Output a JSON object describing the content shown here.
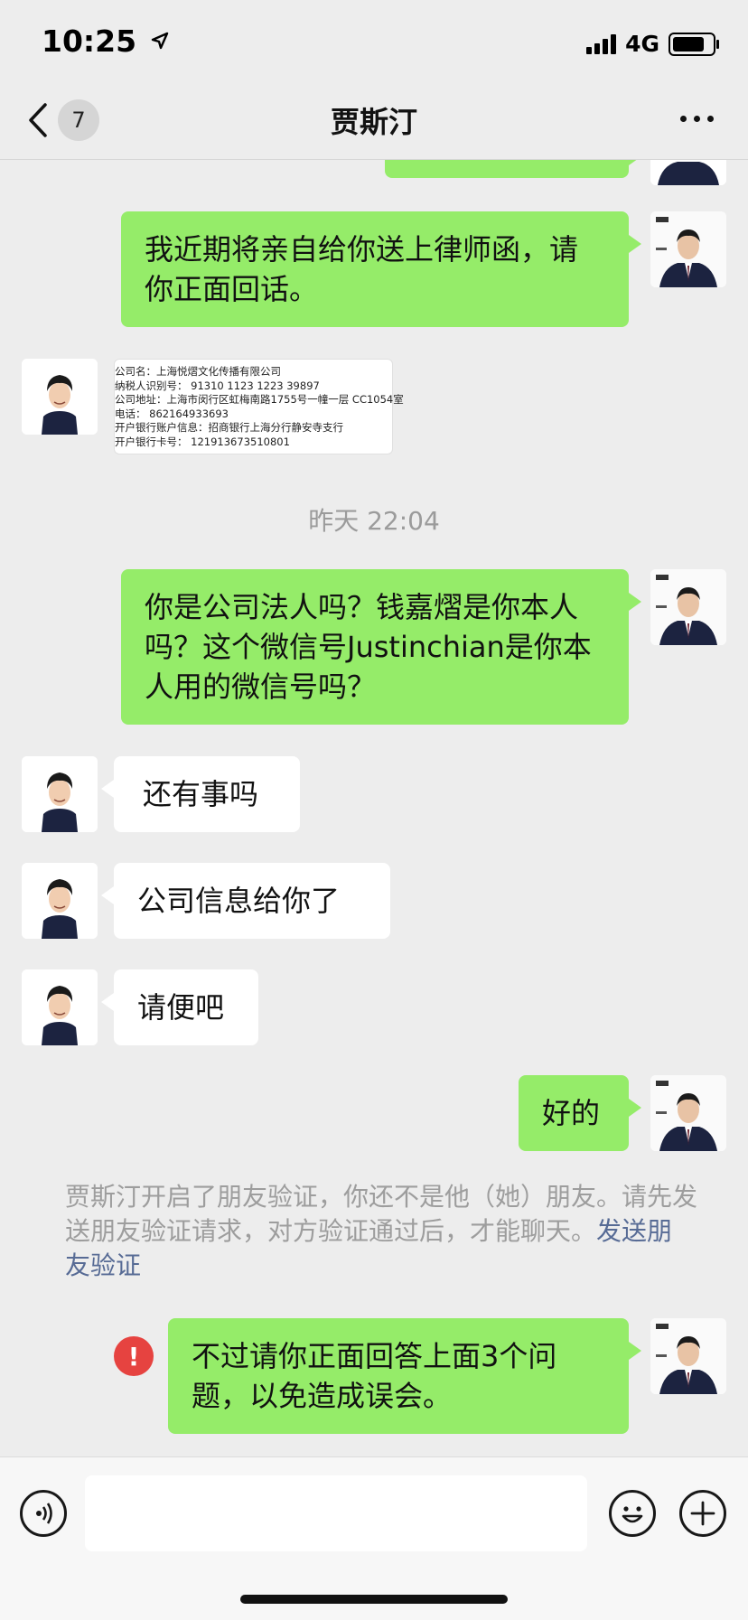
{
  "status": {
    "time": "10:25",
    "network": "4G"
  },
  "nav": {
    "title": "贾斯汀",
    "unread": "7"
  },
  "messages": {
    "m1": "我近期将亲自给你送上律师函，请你正面回话。",
    "card_lines": [
      "公司名：上海悦熠文化传播有限公司",
      "纳税人识别号：  91310 1123 1223 39897",
      "公司地址：上海市闵行区虹梅南路1755号一幢一层 CC1054室",
      "电话：  862164933693",
      "开户银行账户信息：招商银行上海分行静安寺支行",
      "开户银行卡号：  121913673510801"
    ],
    "timestamp": "昨天 22:04",
    "m2": "你是公司法人吗？钱嘉熠是你本人吗？这个微信号Justinchian是你本人用的微信号吗？",
    "m3": "还有事吗",
    "m4": "公司信息给你了",
    "m5": "请便吧",
    "m6": "好的",
    "system_note": "贾斯汀开启了朋友验证，你还不是他（她）朋友。请先发送朋友验证请求，对方验证通过后，才能聊天。",
    "system_link": "发送朋友验证",
    "m7": "不过请你正面回答上面3个问题，以免造成误会。",
    "error_mark": "!"
  },
  "colors": {
    "sent_bubble": "#95ec69",
    "received_bubble": "#ffffff",
    "background": "#ededed",
    "link": "#576b95",
    "error": "#e64340"
  },
  "icons": [
    "location-arrow-icon",
    "signal-icon",
    "battery-icon",
    "back-chevron-icon",
    "more-icon",
    "voice-icon",
    "emoji-icon",
    "add-icon"
  ]
}
